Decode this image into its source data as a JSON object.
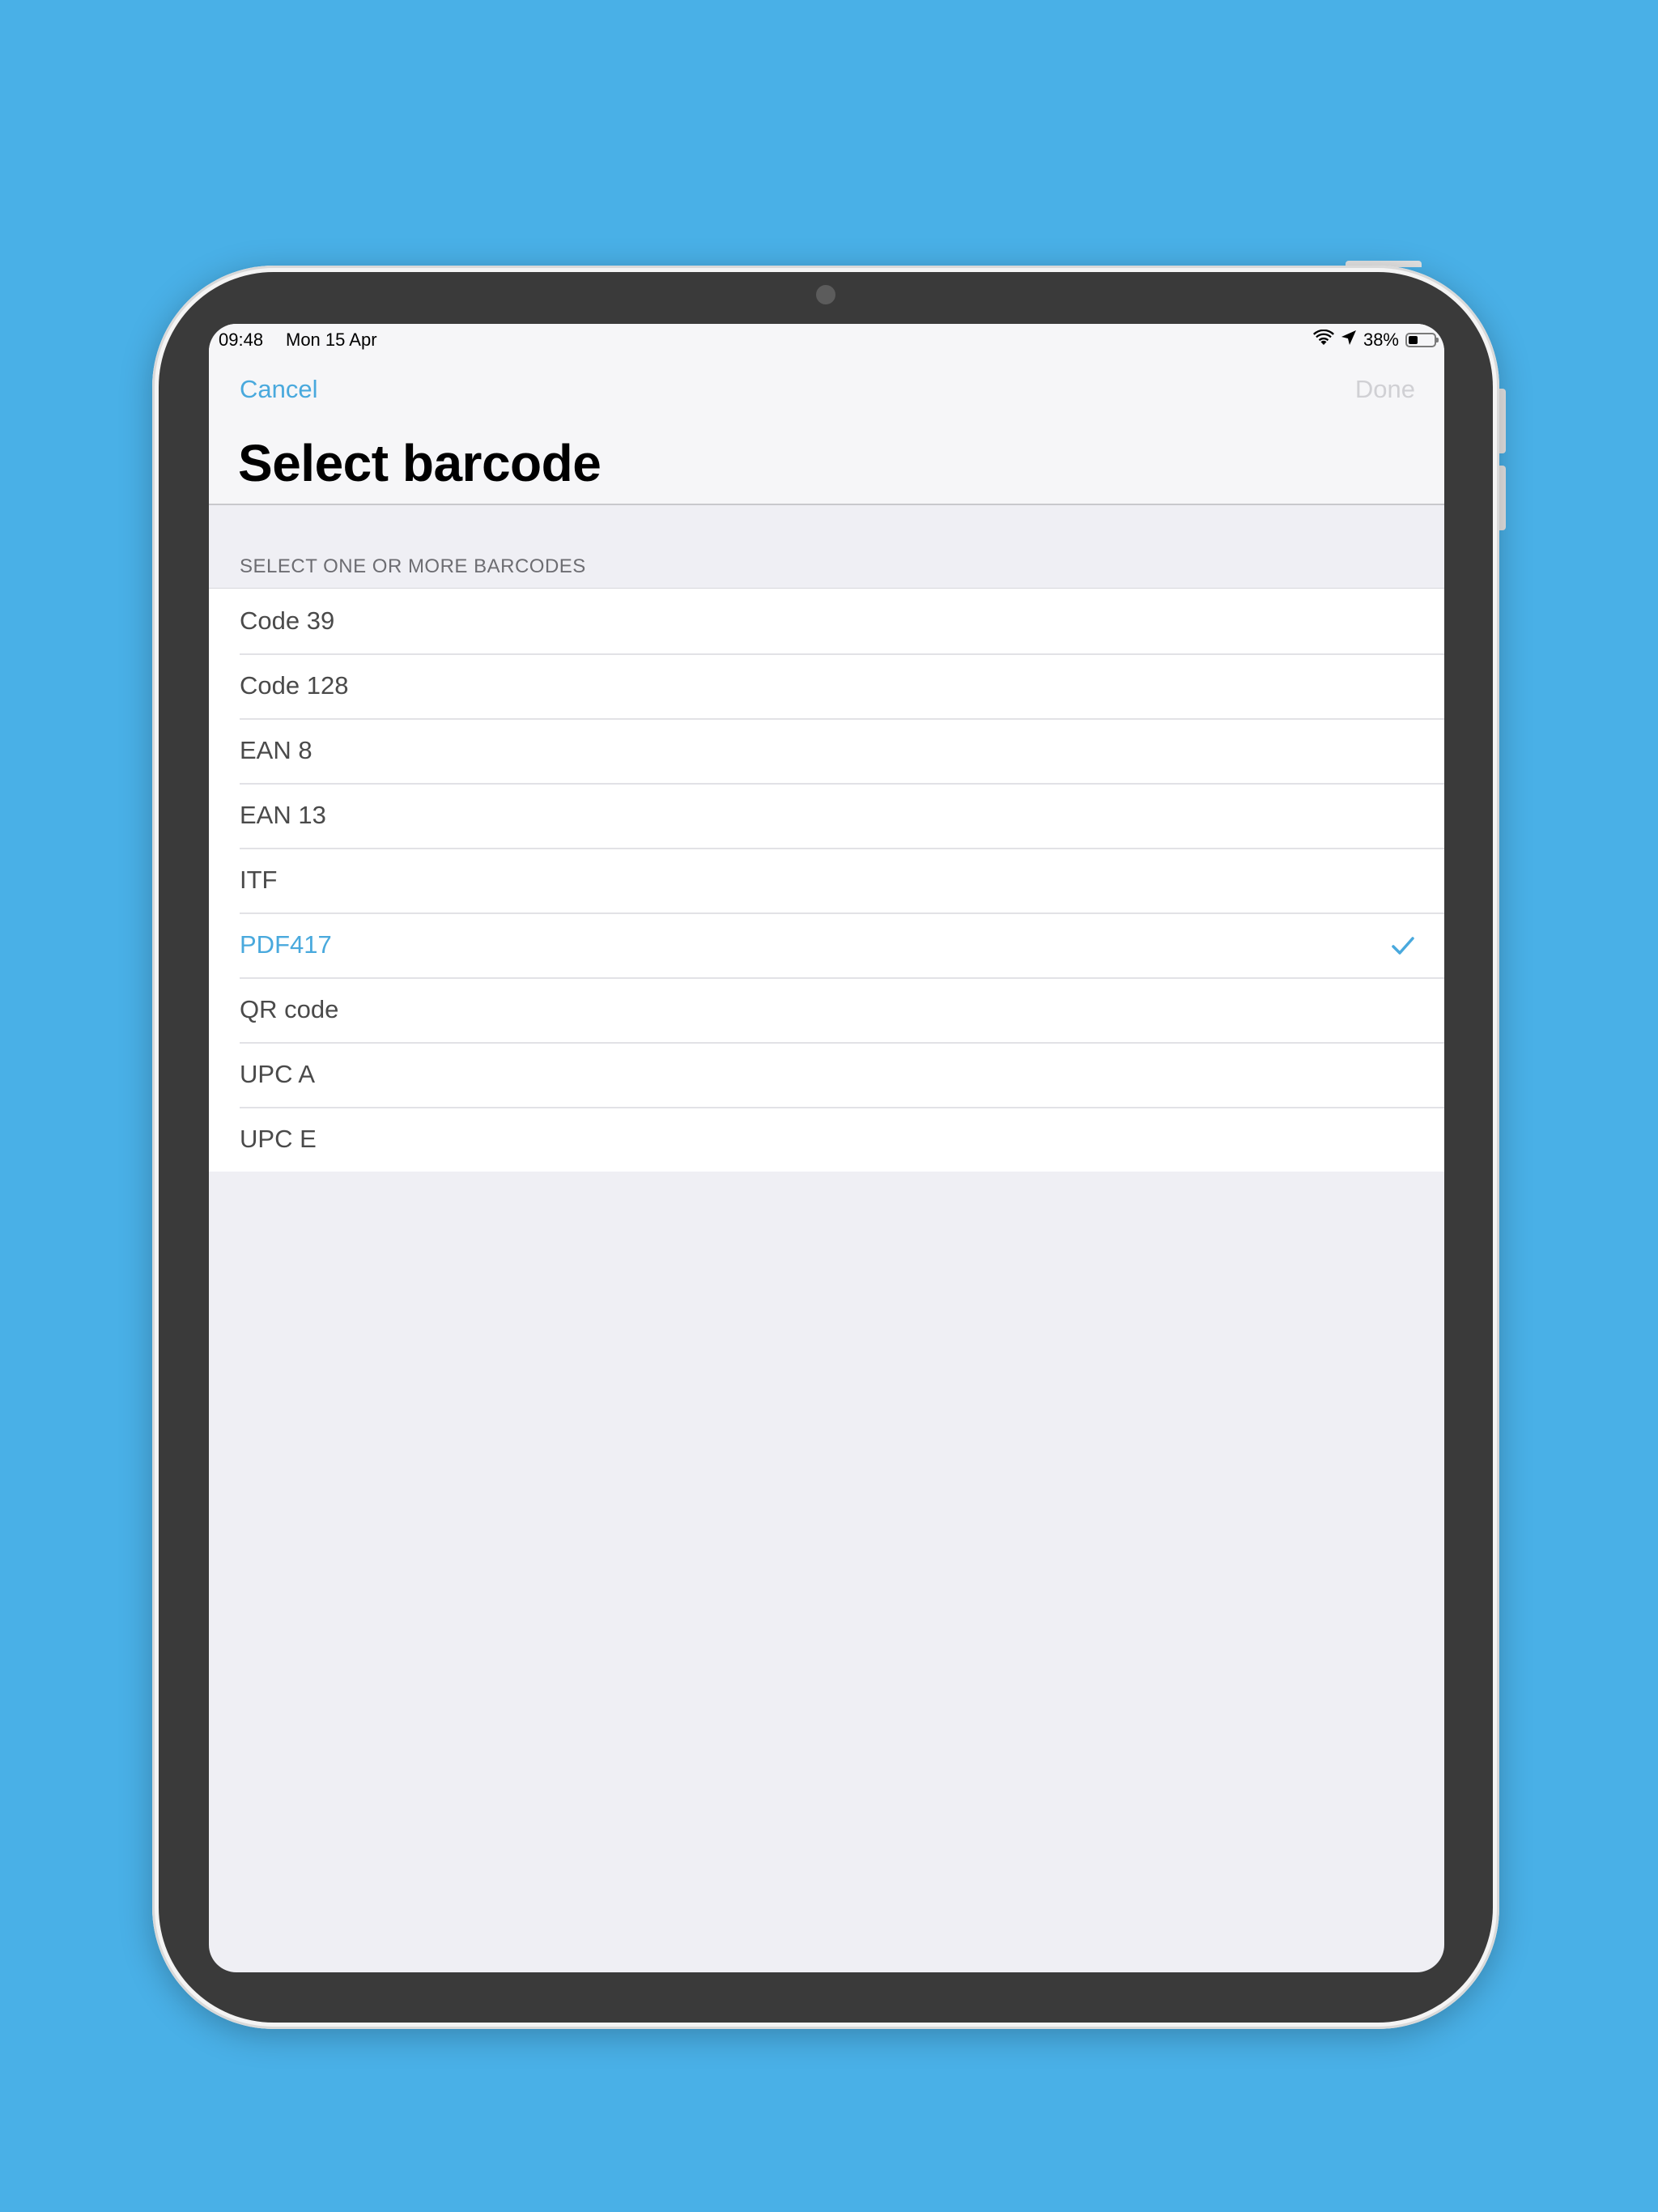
{
  "status_bar": {
    "time": "09:48",
    "date": "Mon 15 Apr",
    "battery_text": "38%",
    "battery_level": 0.38
  },
  "nav": {
    "cancel_label": "Cancel",
    "done_label": "Done",
    "title": "Select barcode"
  },
  "section": {
    "header": "SELECT ONE OR MORE BARCODES"
  },
  "barcodes": [
    {
      "label": "Code 39",
      "selected": false
    },
    {
      "label": "Code 128",
      "selected": false
    },
    {
      "label": "EAN 8",
      "selected": false
    },
    {
      "label": "EAN 13",
      "selected": false
    },
    {
      "label": "ITF",
      "selected": false
    },
    {
      "label": "PDF417",
      "selected": true
    },
    {
      "label": "QR code",
      "selected": false
    },
    {
      "label": "UPC A",
      "selected": false
    },
    {
      "label": "UPC E",
      "selected": false
    }
  ],
  "colors": {
    "background": "#49b0e7",
    "accent": "#49a9dd",
    "disabled": "#d0d0d4"
  },
  "icons": {
    "wifi": "wifi-icon",
    "location": "location-arrow-icon",
    "battery": "battery-icon",
    "check": "checkmark-icon"
  }
}
